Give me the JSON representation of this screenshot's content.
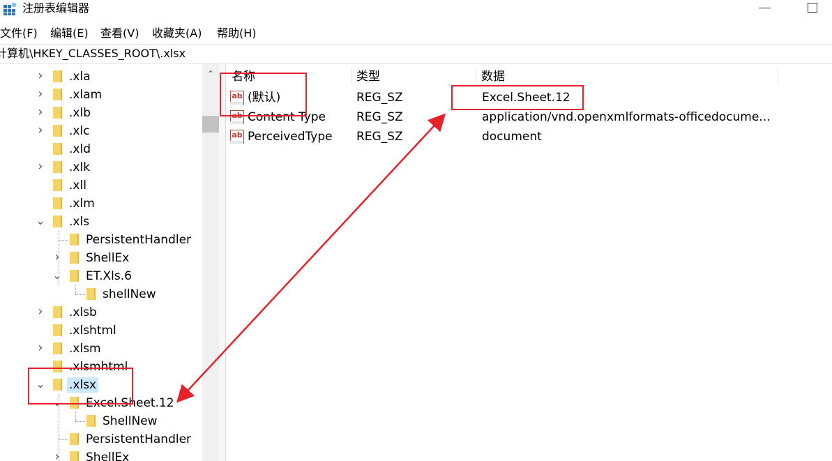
{
  "window": {
    "title": "注册表编辑器"
  },
  "menu": [
    "文件(F)",
    "编辑(E)",
    "查看(V)",
    "收藏夹(A)",
    "帮助(H)"
  ],
  "address": "计算机\\HKEY_CLASSES_ROOT\\.xlsx",
  "tree": [
    {
      "label": ".xla",
      "depth": 0,
      "expander": "collapsed"
    },
    {
      "label": ".xlam",
      "depth": 0,
      "expander": "collapsed"
    },
    {
      "label": ".xlb",
      "depth": 0,
      "expander": "collapsed"
    },
    {
      "label": ".xlc",
      "depth": 0,
      "expander": "collapsed"
    },
    {
      "label": ".xld",
      "depth": 0,
      "expander": "none"
    },
    {
      "label": ".xlk",
      "depth": 0,
      "expander": "collapsed"
    },
    {
      "label": ".xll",
      "depth": 0,
      "expander": "none"
    },
    {
      "label": ".xlm",
      "depth": 0,
      "expander": "none"
    },
    {
      "label": ".xls",
      "depth": 0,
      "expander": "expanded"
    },
    {
      "label": "PersistentHandler",
      "depth": 1,
      "expander": "none"
    },
    {
      "label": "ShellEx",
      "depth": 1,
      "expander": "collapsed"
    },
    {
      "label": "ET.Xls.6",
      "depth": 1,
      "expander": "expanded"
    },
    {
      "label": "shellNew",
      "depth": 2,
      "expander": "none"
    },
    {
      "label": ".xlsb",
      "depth": 0,
      "expander": "collapsed"
    },
    {
      "label": ".xlshtml",
      "depth": 0,
      "expander": "none"
    },
    {
      "label": ".xlsm",
      "depth": 0,
      "expander": "collapsed"
    },
    {
      "label": ".xlsmhtml",
      "depth": 0,
      "expander": "none"
    },
    {
      "label": ".xlsx",
      "depth": 0,
      "expander": "expanded",
      "selected": true
    },
    {
      "label": "Excel.Sheet.12",
      "depth": 1,
      "expander": "expanded"
    },
    {
      "label": "ShellNew",
      "depth": 2,
      "expander": "none"
    },
    {
      "label": "PersistentHandler",
      "depth": 1,
      "expander": "none"
    },
    {
      "label": "ShellEx",
      "depth": 1,
      "expander": "collapsed"
    }
  ],
  "columns": {
    "name": "名称",
    "type": "类型",
    "data": "数据"
  },
  "values": [
    {
      "name": "(默认)",
      "type": "REG_SZ",
      "data": "Excel.Sheet.12"
    },
    {
      "name": "Content Type",
      "type": "REG_SZ",
      "data": "application/vnd.openxmlformats-officedocume..."
    },
    {
      "name": "PerceivedType",
      "type": "REG_SZ",
      "data": "document"
    }
  ],
  "icons": {
    "value_icon": "string-value-ab-icon",
    "folder_icon": "folder-icon",
    "app_icon": "regedit-icon"
  },
  "annotation_color": "#e8222b",
  "selection_color": "#cce8ff"
}
